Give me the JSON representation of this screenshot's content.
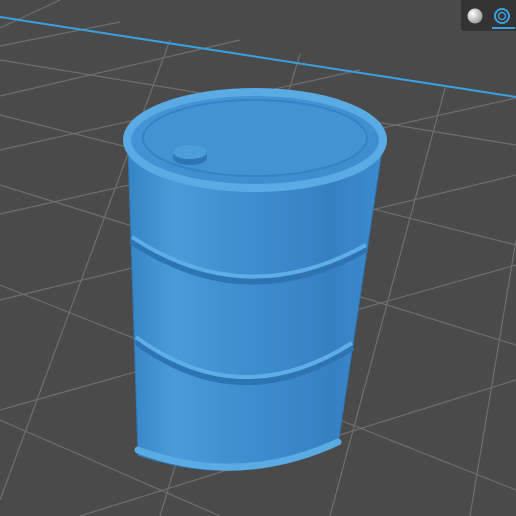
{
  "viewport": {
    "background_color": "#4a4a4a",
    "grid_color": "#6e6e6e",
    "axis_color": "#3aa0e0"
  },
  "model": {
    "name": "oil-drum",
    "color": "#3f8fd0",
    "highlight_color": "#6bb3e8",
    "shadow_color": "#2a6aa6"
  },
  "toolbar": {
    "buttons": [
      {
        "icon": "matcap-sphere-icon",
        "active": false
      },
      {
        "icon": "wireframe-sphere-icon",
        "active": true
      }
    ],
    "accent_color": "#3aa0e0"
  }
}
